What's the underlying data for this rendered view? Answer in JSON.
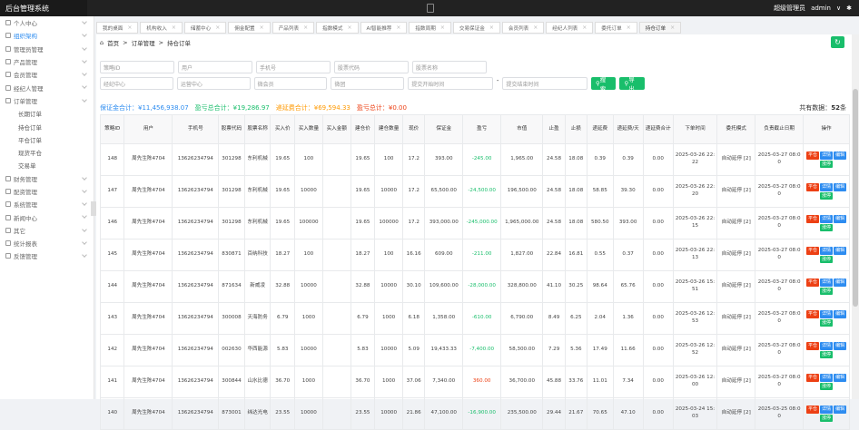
{
  "topbar": {
    "brand": "后台管理系统",
    "user_role": "超级管理员",
    "user_name": "admin",
    "dropdown": "∨"
  },
  "sidebar": {
    "items": [
      {
        "label": "个人中心",
        "active": false
      },
      {
        "label": "组织架构",
        "active": true
      },
      {
        "label": "管理员管理",
        "active": false
      },
      {
        "label": "产品管理",
        "active": false
      },
      {
        "label": "会员管理",
        "active": false
      },
      {
        "label": "经纪人管理",
        "active": false
      },
      {
        "label": "订单管理",
        "active": false
      }
    ],
    "subitems": [
      "长期订单",
      "持仓订单",
      "平仓订单",
      "现货平仓",
      "交易单"
    ],
    "items2": [
      {
        "label": "财务管理"
      },
      {
        "label": "配资管理"
      },
      {
        "label": "系统管理"
      },
      {
        "label": "新闻中心"
      },
      {
        "label": "其它"
      },
      {
        "label": "统计报表"
      },
      {
        "label": "反馈管理"
      }
    ]
  },
  "tabs": [
    {
      "label": "我的桌面"
    },
    {
      "label": "机构收入"
    },
    {
      "label": "储蓄中心"
    },
    {
      "label": "佣金配置"
    },
    {
      "label": "产品列表"
    },
    {
      "label": "指数模式"
    },
    {
      "label": "AI智能推荐"
    },
    {
      "label": "指数周期"
    },
    {
      "label": "交易保证金"
    },
    {
      "label": "会员列表"
    },
    {
      "label": "经纪人列表"
    },
    {
      "label": "委托订单"
    },
    {
      "label": "持仓订单",
      "active": true
    }
  ],
  "breadcrumb": {
    "home": "首页",
    "sep1": ">",
    "level1": "订单管理",
    "sep2": ">",
    "level2": "持仓订单"
  },
  "filters": {
    "row1": [
      "策略ID",
      "用户",
      "手机号",
      "股票代码",
      "股票名称"
    ],
    "row2": [
      "经纪中心",
      "运营中心",
      "微会员",
      "微团",
      "提交开始时间"
    ],
    "dash": "-",
    "end_time": "提交结束时间",
    "search_label": "搜索",
    "export_label": "导出"
  },
  "summary": {
    "capital_label": "保证金合计：",
    "capital_value": "¥11,456,938.07",
    "profit_label": "盈亏总合计：",
    "profit_value": "¥19,286.97",
    "fee_label": "递延费合计：",
    "fee_value": "¥69,594.33",
    "float_label": "盈亏总计：",
    "float_value": "¥0.00",
    "total_label": "共有数据：",
    "total_value": "52",
    "total_unit": "条"
  },
  "table": {
    "headers": [
      "策略ID",
      "用户",
      "手机号",
      "股票代码",
      "股票名称",
      "买入价",
      "买入数量",
      "买入金额",
      "建仓价",
      "建仓数量",
      "现价",
      "保证金",
      "盈亏",
      "市值",
      "止盈",
      "止损",
      "递延费",
      "递延费/天",
      "递延费合计",
      "下单时间",
      "委托模式",
      "负责截止日期",
      "操作"
    ],
    "rows": [
      [
        "148",
        "周先生陈4704",
        "13626234794",
        "301298",
        "东利机械",
        "19.65",
        "100",
        "",
        "19.65",
        "100",
        "17.2",
        "393.00",
        "-245.00",
        "1,965.00",
        "24.58",
        "18.08",
        "0.39",
        "0.39",
        "0.00",
        "2025-03-26 22:22",
        "自动延停 [2]",
        "2025-03-27 08:00",
        ""
      ],
      [
        "147",
        "周先生陈4704",
        "13626234794",
        "301298",
        "东利机械",
        "19.65",
        "10000",
        "",
        "19.65",
        "10000",
        "17.2",
        "65,500.00",
        "-24,500.00",
        "196,500.00",
        "24.58",
        "18.08",
        "58.85",
        "39.30",
        "0.00",
        "2025-03-26 22:20",
        "自动延停 [2]",
        "2025-03-27 08:00",
        ""
      ],
      [
        "146",
        "周先生陈4704",
        "13626234794",
        "301298",
        "东利机械",
        "19.65",
        "100000",
        "",
        "19.65",
        "100000",
        "17.2",
        "393,000.00",
        "-245,000.00",
        "1,965,000.00",
        "24.58",
        "18.08",
        "580.50",
        "393.00",
        "0.00",
        "2025-03-26 22:15",
        "自动延停 [2]",
        "2025-03-27 08:00",
        ""
      ],
      [
        "145",
        "周先生陈4704",
        "13626234794",
        "830871",
        "百纳科技",
        "18.27",
        "100",
        "",
        "18.27",
        "100",
        "16.16",
        "609.00",
        "-211.00",
        "1,827.00",
        "22.84",
        "16.81",
        "0.55",
        "0.37",
        "0.00",
        "2025-03-26 22:13",
        "自动延停 [2]",
        "2025-03-27 08:00",
        ""
      ],
      [
        "144",
        "周先生陈4704",
        "13626234794",
        "871634",
        "新威凌",
        "32.88",
        "10000",
        "",
        "32.88",
        "10000",
        "30.10",
        "109,600.00",
        "-28,000.00",
        "328,800.00",
        "41.10",
        "30.25",
        "98.64",
        "65.76",
        "0.00",
        "2025-03-26 15:51",
        "自动延停 [2]",
        "2025-03-27 08:00",
        ""
      ],
      [
        "143",
        "周先生陈4704",
        "13626234794",
        "300008",
        "天海防务",
        "6.79",
        "1000",
        "",
        "6.79",
        "1000",
        "6.18",
        "1,358.00",
        "-610.00",
        "6,790.00",
        "8.49",
        "6.25",
        "2.04",
        "1.36",
        "0.00",
        "2025-03-26 12:53",
        "自动延停 [2]",
        "2025-03-27 08:00",
        ""
      ],
      [
        "142",
        "周先生陈4704",
        "13626234794",
        "002630",
        "华西能源",
        "5.83",
        "10000",
        "",
        "5.83",
        "10000",
        "5.09",
        "19,433.33",
        "-7,400.00",
        "58,300.00",
        "7.29",
        "5.36",
        "17.49",
        "11.66",
        "0.00",
        "2025-03-26 12:52",
        "自动延停 [2]",
        "2025-03-27 08:00",
        ""
      ],
      [
        "141",
        "周先生陈4704",
        "13626234794",
        "300844",
        "山水比德",
        "36.70",
        "1000",
        "",
        "36.70",
        "1000",
        "37.06",
        "7,340.00",
        "360.00",
        "36,700.00",
        "45.88",
        "33.76",
        "11.01",
        "7.34",
        "0.00",
        "2025-03-26 12:00",
        "自动延停 [2]",
        "2025-03-27 08:00",
        ""
      ],
      [
        "140",
        "周先生陈4704",
        "13626234794",
        "873001",
        "纬达光电",
        "23.55",
        "10000",
        "",
        "23.55",
        "10000",
        "21.86",
        "47,100.00",
        "-16,900.00",
        "235,500.00",
        "29.44",
        "21.67",
        "70.65",
        "47.10",
        "0.00",
        "2025-03-24 15:03",
        "自动延停 [2]",
        "2025-03-25 08:00",
        ""
      ]
    ],
    "op_labels": [
      "平仓",
      "详情",
      "编辑",
      "涨停"
    ]
  },
  "colors": {
    "accent": "#2d8cf0",
    "green": "#19be6b",
    "red": "#ed4014",
    "orange": "#ff9900"
  }
}
